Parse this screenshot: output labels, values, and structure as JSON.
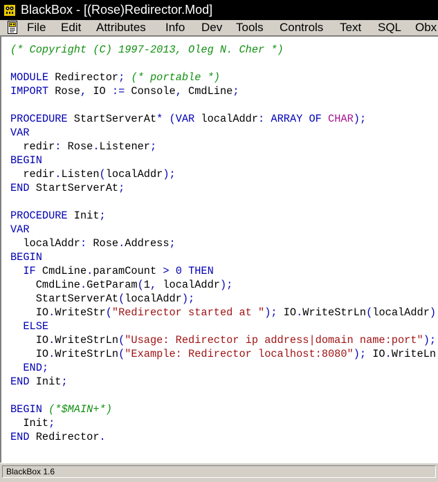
{
  "window": {
    "title": "BlackBox - [(Rose)Redirector.Mod]"
  },
  "menu": [
    {
      "id": "file",
      "label": "File"
    },
    {
      "id": "edit",
      "label": "Edit"
    },
    {
      "id": "attributes",
      "label": "Attributes"
    },
    {
      "id": "info",
      "label": "Info"
    },
    {
      "id": "dev",
      "label": "Dev"
    },
    {
      "id": "tools",
      "label": "Tools"
    },
    {
      "id": "controls",
      "label": "Controls"
    },
    {
      "id": "text",
      "label": "Text"
    },
    {
      "id": "sql",
      "label": "SQL"
    },
    {
      "id": "obx",
      "label": "Obx"
    }
  ],
  "code": [
    [
      {
        "t": "(* Copyright (C) 1997-2013, Oleg N. Cher *)",
        "c": "cm"
      }
    ],
    [],
    [
      {
        "t": "MODULE",
        "c": "kw"
      },
      {
        "t": " Redirector"
      },
      {
        "t": ";",
        "c": "pu"
      },
      {
        "t": " "
      },
      {
        "t": "(* portable *)",
        "c": "cm"
      }
    ],
    [
      {
        "t": "IMPORT",
        "c": "kw"
      },
      {
        "t": " Rose"
      },
      {
        "t": ",",
        "c": "pu"
      },
      {
        "t": " IO "
      },
      {
        "t": ":=",
        "c": "pu"
      },
      {
        "t": " Console"
      },
      {
        "t": ",",
        "c": "pu"
      },
      {
        "t": " CmdLine"
      },
      {
        "t": ";",
        "c": "pu"
      }
    ],
    [],
    [
      {
        "t": "PROCEDURE",
        "c": "kw"
      },
      {
        "t": " StartServerAt"
      },
      {
        "t": "*",
        "c": "pu"
      },
      {
        "t": " "
      },
      {
        "t": "(",
        "c": "pu"
      },
      {
        "t": "VAR",
        "c": "kw"
      },
      {
        "t": " localAddr"
      },
      {
        "t": ":",
        "c": "pu"
      },
      {
        "t": " "
      },
      {
        "t": "ARRAY OF",
        "c": "kw"
      },
      {
        "t": " "
      },
      {
        "t": "CHAR",
        "c": "ty"
      },
      {
        "t": ");",
        "c": "pu"
      }
    ],
    [
      {
        "t": "VAR",
        "c": "kw"
      }
    ],
    [
      {
        "t": "  redir"
      },
      {
        "t": ":",
        "c": "pu"
      },
      {
        "t": " Rose"
      },
      {
        "t": ".",
        "c": "pu"
      },
      {
        "t": "Listener"
      },
      {
        "t": ";",
        "c": "pu"
      }
    ],
    [
      {
        "t": "BEGIN",
        "c": "kw"
      }
    ],
    [
      {
        "t": "  redir"
      },
      {
        "t": ".",
        "c": "pu"
      },
      {
        "t": "Listen"
      },
      {
        "t": "(",
        "c": "pu"
      },
      {
        "t": "localAddr"
      },
      {
        "t": ");",
        "c": "pu"
      }
    ],
    [
      {
        "t": "END",
        "c": "kw"
      },
      {
        "t": " StartServerAt"
      },
      {
        "t": ";",
        "c": "pu"
      }
    ],
    [],
    [
      {
        "t": "PROCEDURE",
        "c": "kw"
      },
      {
        "t": " Init"
      },
      {
        "t": ";",
        "c": "pu"
      }
    ],
    [
      {
        "t": "VAR",
        "c": "kw"
      }
    ],
    [
      {
        "t": "  localAddr"
      },
      {
        "t": ":",
        "c": "pu"
      },
      {
        "t": " Rose"
      },
      {
        "t": ".",
        "c": "pu"
      },
      {
        "t": "Address"
      },
      {
        "t": ";",
        "c": "pu"
      }
    ],
    [
      {
        "t": "BEGIN",
        "c": "kw"
      }
    ],
    [
      {
        "t": "  "
      },
      {
        "t": "IF",
        "c": "kw"
      },
      {
        "t": " CmdLine"
      },
      {
        "t": ".",
        "c": "pu"
      },
      {
        "t": "paramCount "
      },
      {
        "t": ">",
        "c": "pu"
      },
      {
        "t": " "
      },
      {
        "t": "0",
        "c": "pu"
      },
      {
        "t": " "
      },
      {
        "t": "THEN",
        "c": "kw"
      }
    ],
    [
      {
        "t": "    CmdLine"
      },
      {
        "t": ".",
        "c": "pu"
      },
      {
        "t": "GetParam"
      },
      {
        "t": "(",
        "c": "pu"
      },
      {
        "t": "1"
      },
      {
        "t": ",",
        "c": "pu"
      },
      {
        "t": " localAddr"
      },
      {
        "t": ");",
        "c": "pu"
      }
    ],
    [
      {
        "t": "    StartServerAt"
      },
      {
        "t": "(",
        "c": "pu"
      },
      {
        "t": "localAddr"
      },
      {
        "t": ");",
        "c": "pu"
      }
    ],
    [
      {
        "t": "    IO"
      },
      {
        "t": ".",
        "c": "pu"
      },
      {
        "t": "WriteStr"
      },
      {
        "t": "(",
        "c": "pu"
      },
      {
        "t": "\"Redirector started at \"",
        "c": "st"
      },
      {
        "t": ");",
        "c": "pu"
      },
      {
        "t": " IO"
      },
      {
        "t": ".",
        "c": "pu"
      },
      {
        "t": "WriteStrLn"
      },
      {
        "t": "(",
        "c": "pu"
      },
      {
        "t": "localAddr"
      },
      {
        "t": ");",
        "c": "pu"
      }
    ],
    [
      {
        "t": "  "
      },
      {
        "t": "ELSE",
        "c": "kw"
      }
    ],
    [
      {
        "t": "    IO"
      },
      {
        "t": ".",
        "c": "pu"
      },
      {
        "t": "WriteStrLn"
      },
      {
        "t": "(",
        "c": "pu"
      },
      {
        "t": "\"Usage: Redirector ip address|domain name:port\"",
        "c": "st"
      },
      {
        "t": ");",
        "c": "pu"
      }
    ],
    [
      {
        "t": "    IO"
      },
      {
        "t": ".",
        "c": "pu"
      },
      {
        "t": "WriteStrLn"
      },
      {
        "t": "(",
        "c": "pu"
      },
      {
        "t": "\"Example: Redirector localhost:8080\"",
        "c": "st"
      },
      {
        "t": ");",
        "c": "pu"
      },
      {
        "t": " IO"
      },
      {
        "t": ".",
        "c": "pu"
      },
      {
        "t": "WriteLn"
      },
      {
        "t": ";",
        "c": "pu"
      }
    ],
    [
      {
        "t": "  "
      },
      {
        "t": "END",
        "c": "kw"
      },
      {
        "t": ";",
        "c": "pu"
      }
    ],
    [
      {
        "t": "END",
        "c": "kw"
      },
      {
        "t": " Init"
      },
      {
        "t": ";",
        "c": "pu"
      }
    ],
    [],
    [
      {
        "t": "BEGIN",
        "c": "kw"
      },
      {
        "t": " "
      },
      {
        "t": "(*$MAIN+*)",
        "c": "cm"
      }
    ],
    [
      {
        "t": "  Init"
      },
      {
        "t": ";",
        "c": "pu"
      }
    ],
    [
      {
        "t": "END",
        "c": "kw"
      },
      {
        "t": " Redirector"
      },
      {
        "t": ".",
        "c": "pu"
      }
    ]
  ],
  "status": {
    "text": "BlackBox 1.6"
  }
}
